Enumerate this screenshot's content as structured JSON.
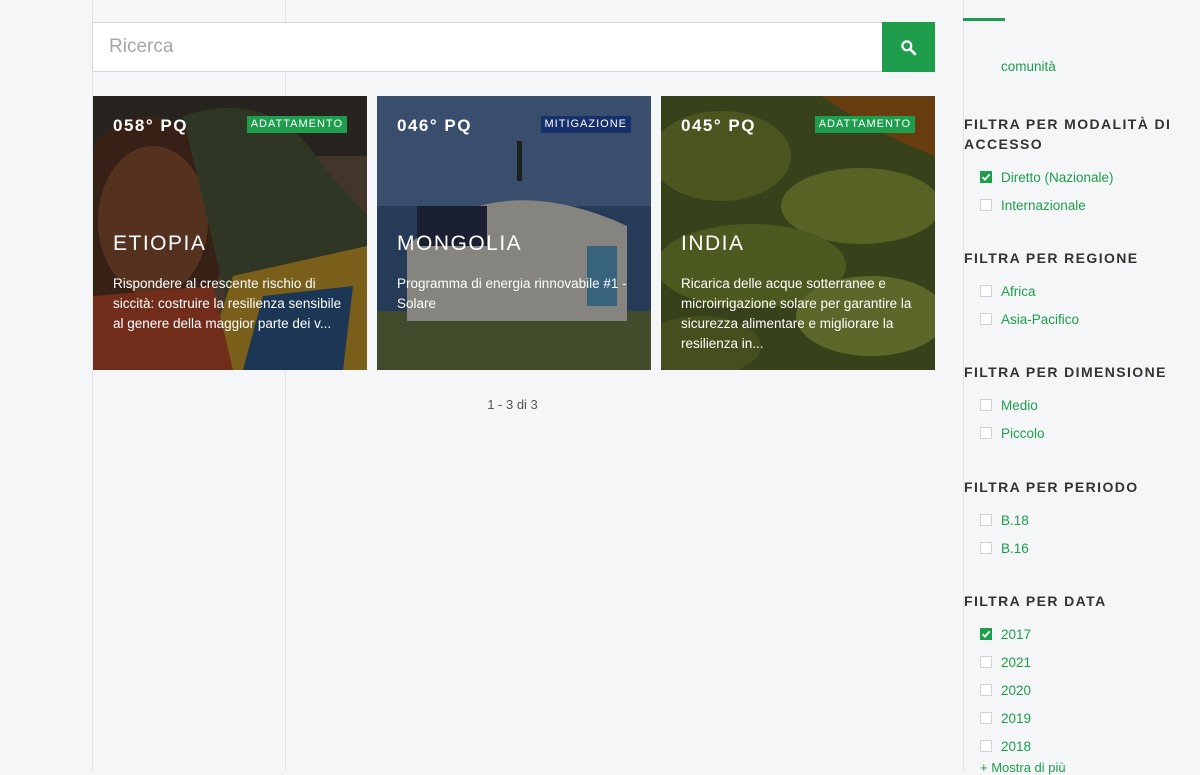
{
  "search": {
    "placeholder": "Ricerca",
    "value": ""
  },
  "icons": {
    "search": "search-icon",
    "check": "check-icon"
  },
  "colors": {
    "accent": "#1e9e4d",
    "badge_blue": "#15306b"
  },
  "cards": [
    {
      "code": "058° PQ",
      "badge": "ADATTAMENTO",
      "badge_color": "green",
      "country": "ETIOPIA",
      "description": "Rispondere al crescente rischio di siccità: costruire la resilienza sensibile al genere della maggior parte dei v..."
    },
    {
      "code": "046° PQ",
      "badge": "MITIGAZIONE",
      "badge_color": "blue",
      "country": "MONGOLIA",
      "description": "Programma di energia rinnovabile #1 - Solare"
    },
    {
      "code": "045° PQ",
      "badge": "ADATTAMENTO",
      "badge_color": "green",
      "country": "INDIA",
      "description": "Ricarica delle acque sotterranee e microirrigazione solare per garantire la sicurezza alimentare e migliorare la resilienza in..."
    }
  ],
  "pagination": "1 - 3 di 3",
  "filters": {
    "community_label": "comunità",
    "groups": [
      {
        "title": "FILTRA PER MODALITÀ DI ACCESSO",
        "options": [
          {
            "label": "Diretto (Nazionale)",
            "checked": true
          },
          {
            "label": "Internazionale",
            "checked": false
          }
        ]
      },
      {
        "title": "FILTRA PER REGIONE",
        "options": [
          {
            "label": "Africa",
            "checked": false
          },
          {
            "label": "Asia-Pacifico",
            "checked": false
          }
        ]
      },
      {
        "title": "FILTRA PER DIMENSIONE",
        "options": [
          {
            "label": "Medio",
            "checked": false
          },
          {
            "label": "Piccolo",
            "checked": false
          }
        ]
      },
      {
        "title": "FILTRA PER PERIODO",
        "options": [
          {
            "label": "B.18",
            "checked": false
          },
          {
            "label": "B.16",
            "checked": false
          }
        ]
      },
      {
        "title": "FILTRA PER DATA",
        "options": [
          {
            "label": "2017",
            "checked": true
          },
          {
            "label": "2021",
            "checked": false
          },
          {
            "label": "2020",
            "checked": false
          },
          {
            "label": "2019",
            "checked": false
          },
          {
            "label": "2018",
            "checked": false
          }
        ]
      }
    ],
    "more_label": "+ Mostra di più"
  }
}
